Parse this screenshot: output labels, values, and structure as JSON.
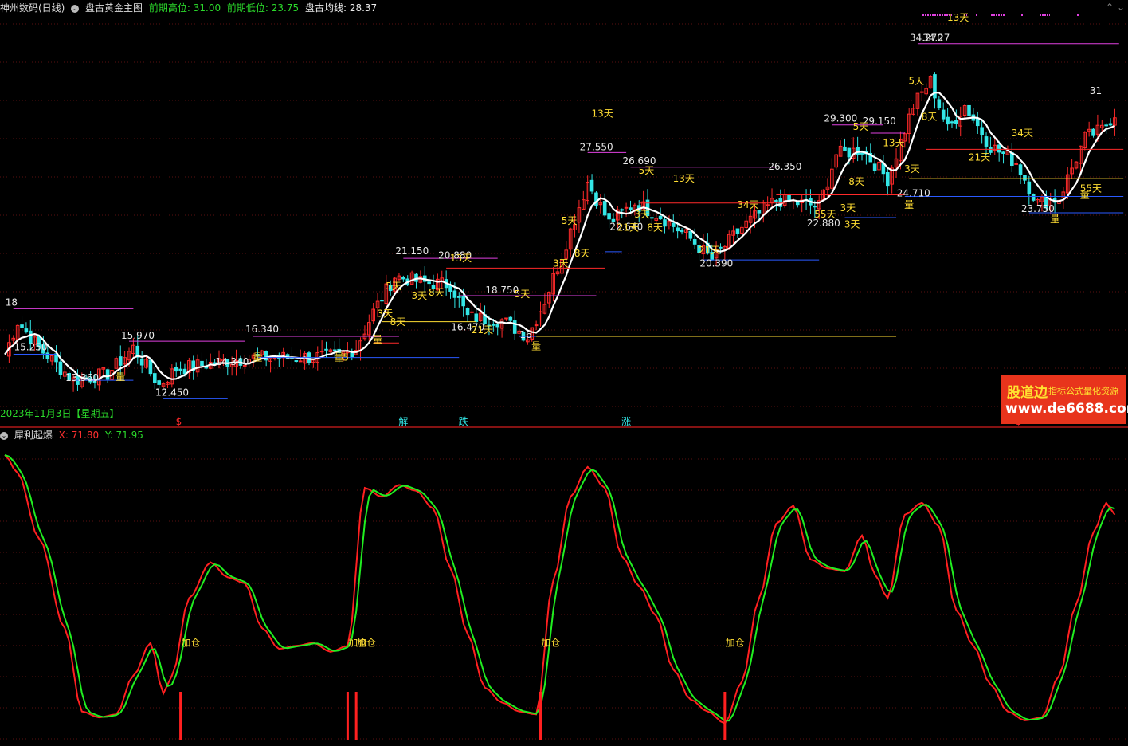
{
  "header": {
    "stock": "神州数码(日线)",
    "indicator": "盘古黄金主图",
    "high_label": "前期高位: 31.00",
    "low_label": "前期低位: 23.75",
    "avg_label": "盘古均线: 28.37"
  },
  "sub_header": {
    "indicator": "犀利起爆",
    "x_label": "X: 71.80",
    "y_label": "Y: 71.95"
  },
  "date_text": "2023年11月3日【星期五】",
  "watermark": {
    "line1": "股道边",
    "line2": "指标公式量化资源",
    "line3": "www.de6688.com"
  },
  "colors": {
    "up": "#ff2a2a",
    "down": "#33e6e6",
    "ma": "#ffffff",
    "x_line": "#ff2020",
    "y_line": "#20ee20",
    "label": "#ffdd33",
    "magenta": "#e040e0",
    "blue": "#2a5aff"
  },
  "chart_data": [
    {
      "type": "line",
      "title": "盘古黄金主图",
      "ylim": [
        11.5,
        36
      ],
      "price_labels": [
        {
          "i": 2,
          "v": 18.0,
          "text": "18"
        },
        {
          "i": 4,
          "v": 15.25,
          "text": "15.250"
        },
        {
          "i": 16,
          "v": 13.36,
          "text": "13.360"
        },
        {
          "i": 29,
          "v": 15.97,
          "text": "15.970"
        },
        {
          "i": 37,
          "v": 12.45,
          "text": "12.45"
        },
        {
          "i": 37,
          "v": 12.45,
          "text": "12.450"
        },
        {
          "i": 51,
          "v": 14.34,
          "text": "14.340"
        },
        {
          "i": 58,
          "v": 16.34,
          "text": "16.340"
        },
        {
          "i": 93,
          "v": 21.15,
          "text": "21.150"
        },
        {
          "i": 103,
          "v": 20.88,
          "text": "20.880"
        },
        {
          "i": 106,
          "v": 16.47,
          "text": "16.470"
        },
        {
          "i": 114,
          "v": 18.75,
          "text": "18.750"
        },
        {
          "i": 122,
          "v": 16.0,
          "text": "16"
        },
        {
          "i": 136,
          "v": 27.55,
          "text": "27.550"
        },
        {
          "i": 143,
          "v": 22.64,
          "text": "22.640"
        },
        {
          "i": 146,
          "v": 26.69,
          "text": "26.690"
        },
        {
          "i": 164,
          "v": 20.39,
          "text": "20.390"
        },
        {
          "i": 180,
          "v": 26.35,
          "text": "26.350"
        },
        {
          "i": 189,
          "v": 22.88,
          "text": "22.880"
        },
        {
          "i": 193,
          "v": 29.3,
          "text": "29.300"
        },
        {
          "i": 202,
          "v": 29.15,
          "text": "29.150"
        },
        {
          "i": 210,
          "v": 24.71,
          "text": "24.710"
        },
        {
          "i": 213,
          "v": 34.27,
          "text": "34.270"
        },
        {
          "i": 216,
          "v": 34.27,
          "text": "34.27"
        },
        {
          "i": 239,
          "v": 23.75,
          "text": "23.750"
        },
        {
          "i": 255,
          "v": 31.0,
          "text": "31"
        }
      ],
      "day_labels": [
        {
          "i": 88,
          "v": 17.5,
          "text": "3天"
        },
        {
          "i": 91,
          "v": 17.0,
          "text": "8天"
        },
        {
          "i": 90,
          "v": 19.2,
          "text": "5天"
        },
        {
          "i": 96,
          "v": 18.6,
          "text": "3天"
        },
        {
          "i": 100,
          "v": 18.8,
          "text": "8天"
        },
        {
          "i": 105,
          "v": 20.9,
          "text": "13天"
        },
        {
          "i": 110,
          "v": 16.5,
          "text": "21天"
        },
        {
          "i": 120,
          "v": 18.7,
          "text": "5天"
        },
        {
          "i": 129,
          "v": 20.6,
          "text": "3天"
        },
        {
          "i": 131,
          "v": 23.2,
          "text": "5天"
        },
        {
          "i": 134,
          "v": 21.2,
          "text": "8天"
        },
        {
          "i": 138,
          "v": 29.8,
          "text": "13天"
        },
        {
          "i": 144,
          "v": 22.8,
          "text": "21天"
        },
        {
          "i": 148,
          "v": 23.6,
          "text": "3天"
        },
        {
          "i": 149,
          "v": 26.3,
          "text": "5天"
        },
        {
          "i": 151,
          "v": 22.8,
          "text": "8天"
        },
        {
          "i": 157,
          "v": 25.8,
          "text": "13天"
        },
        {
          "i": 163,
          "v": 21.4,
          "text": "21天"
        },
        {
          "i": 172,
          "v": 24.2,
          "text": "34天"
        },
        {
          "i": 190,
          "v": 23.6,
          "text": "55天"
        },
        {
          "i": 197,
          "v": 23.0,
          "text": "3天"
        },
        {
          "i": 199,
          "v": 29.0,
          "text": "5天"
        },
        {
          "i": 198,
          "v": 25.6,
          "text": "8天"
        },
        {
          "i": 196,
          "v": 24.0,
          "text": "3天"
        },
        {
          "i": 206,
          "v": 28.0,
          "text": "13天"
        },
        {
          "i": 211,
          "v": 26.4,
          "text": "3天"
        },
        {
          "i": 221,
          "v": 35.7,
          "text": "13天"
        },
        {
          "i": 212,
          "v": 31.8,
          "text": "5天"
        },
        {
          "i": 215,
          "v": 29.6,
          "text": "8天"
        },
        {
          "i": 226,
          "v": 27.1,
          "text": "21天"
        },
        {
          "i": 236,
          "v": 28.6,
          "text": "34天"
        },
        {
          "i": 252,
          "v": 25.2,
          "text": "55天"
        }
      ],
      "markers": [
        {
          "i": 27,
          "v": 13.6,
          "text": "量"
        },
        {
          "i": 59,
          "v": 14.8,
          "text": "量"
        },
        {
          "i": 78,
          "v": 14.8,
          "text": "量"
        },
        {
          "i": 80,
          "v": 14.8,
          "text": "5"
        },
        {
          "i": 87,
          "v": 15.9,
          "text": "量"
        },
        {
          "i": 124,
          "v": 15.5,
          "text": "量"
        },
        {
          "i": 211,
          "v": 24.2,
          "text": "量"
        },
        {
          "i": 245,
          "v": 23.3,
          "text": "量"
        },
        {
          "i": 252,
          "v": 24.8,
          "text": "量"
        }
      ],
      "signals": [
        {
          "i": 41,
          "text": "$"
        },
        {
          "i": 93,
          "text": "解"
        },
        {
          "i": 107,
          "text": "跌"
        },
        {
          "i": 145,
          "text": "涨"
        },
        {
          "i": 237,
          "text": "$"
        }
      ]
    },
    {
      "type": "line",
      "title": "犀利起爆",
      "ylim": [
        0,
        100
      ],
      "series": [
        {
          "name": "X"
        },
        {
          "name": "Y"
        }
      ],
      "labels": [
        {
          "i": 43,
          "v": 32,
          "text": "加仓"
        },
        {
          "i": 82,
          "v": 32,
          "text": "加仓"
        },
        {
          "i": 84,
          "v": 32,
          "text": "加仓"
        },
        {
          "i": 127,
          "v": 32,
          "text": "加仓"
        },
        {
          "i": 170,
          "v": 32,
          "text": "加仓"
        }
      ],
      "bars": [
        {
          "i": 41
        },
        {
          "i": 80
        },
        {
          "i": 82
        },
        {
          "i": 125
        },
        {
          "i": 168
        }
      ]
    }
  ]
}
